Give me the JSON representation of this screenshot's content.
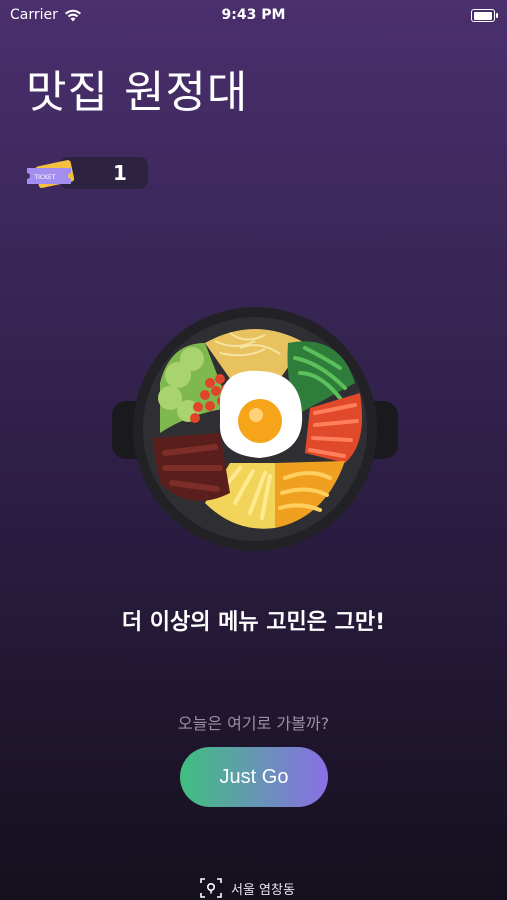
{
  "status_bar": {
    "carrier": "Carrier",
    "time": "9:43 PM",
    "battery_level": 1.0
  },
  "app": {
    "title": "맛집 원정대"
  },
  "ticket": {
    "label": "TICKET",
    "count": "1",
    "colors": {
      "ticket_front": "#a38ef0",
      "ticket_back": "#f5c040"
    }
  },
  "hero": {
    "image_icon": "bibimbap-bowl-illustration",
    "headline": "더 이상의 메뉴 고민은 그만!"
  },
  "prompt": {
    "subtitle": "오늘은 여기로 가볼까?",
    "button_label": "Just Go",
    "button_gradient": [
      "#3fbf7f",
      "#8a6fe6"
    ]
  },
  "location": {
    "icon": "location-target-icon",
    "name": "서울 염창동"
  }
}
